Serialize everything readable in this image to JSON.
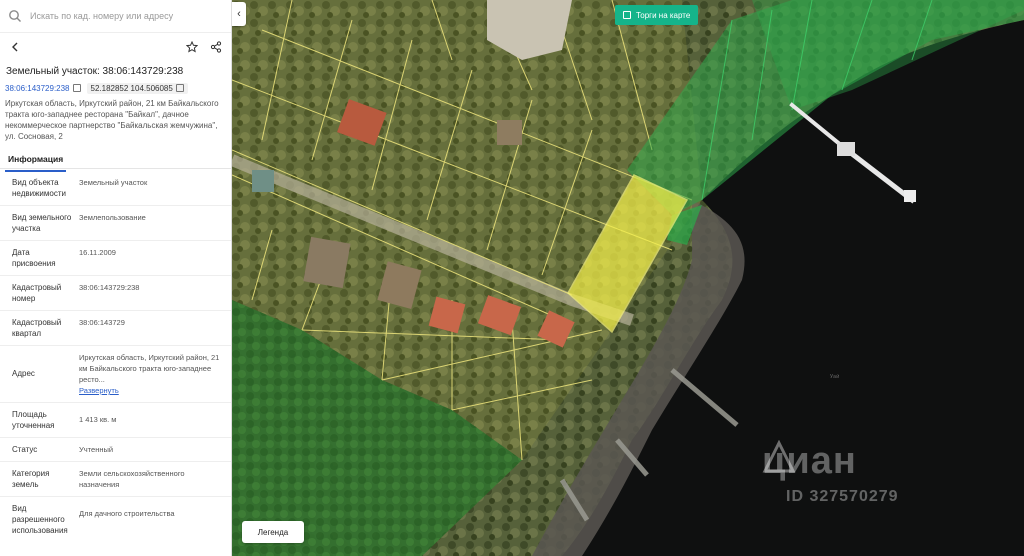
{
  "search": {
    "placeholder": "Искать по кад. номеру или адресу"
  },
  "object": {
    "title": "Земельный участок: 38:06:143729:238",
    "cadastral_number": "38:06:143729:238",
    "coordinates": "52.182852 104.506085",
    "address": "Иркутская область, Иркутский район, 21 км Байкальского тракта юго-западнее ресторана \"Байкал\", дачное некоммерческое партнерство \"Байкальская жемчужина\", ул. Сосновая, 2"
  },
  "tabs": [
    {
      "label": "Информация"
    }
  ],
  "info_rows": [
    {
      "key": "Вид объекта недвижимости",
      "value": "Земельный участок"
    },
    {
      "key": "Вид земельного участка",
      "value": "Землепользование"
    },
    {
      "key": "Дата присвоения",
      "value": "16.11.2009"
    },
    {
      "key": "Кадастровый номер",
      "value": "38:06:143729:238"
    },
    {
      "key": "Кадастровый квартал",
      "value": "38:06:143729"
    },
    {
      "key": "Адрес",
      "value": "Иркутская область, Иркутский район, 21 км Байкальского тракта юго-западнее ресто...",
      "link": "Развернуть"
    },
    {
      "key": "Площадь уточненная",
      "value": "1 413 кв. м"
    },
    {
      "key": "Статус",
      "value": "Учтенный"
    },
    {
      "key": "Категория земель",
      "value": "Земли сельскохозяйственного назначения"
    },
    {
      "key": "Вид разрешенного использования",
      "value": "Для дачного строительства"
    }
  ],
  "map": {
    "auction_button": "Торги на карте",
    "legend_button": "Легенда",
    "watermark_brand": "циан",
    "watermark_id": "ID 327570279",
    "lake_label": "Уай"
  },
  "colors": {
    "accent": "#15b48a",
    "link": "#2a5ec9",
    "selected_parcel": "#f3ef4a",
    "zone_green": "#2ea84a"
  }
}
